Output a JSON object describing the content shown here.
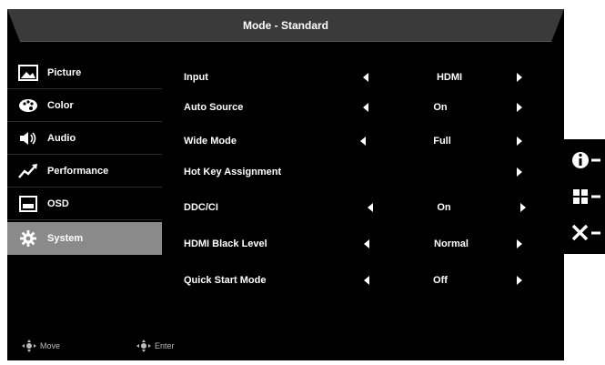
{
  "osd": {
    "title": "Mode - Standard"
  },
  "sidebar": {
    "items": [
      {
        "label": "Picture",
        "icon": "picture-icon"
      },
      {
        "label": "Color",
        "icon": "color-icon"
      },
      {
        "label": "Audio",
        "icon": "audio-icon"
      },
      {
        "label": "Performance",
        "icon": "performance-icon"
      },
      {
        "label": "OSD",
        "icon": "osd-icon"
      },
      {
        "label": "System",
        "icon": "gear-icon",
        "active": true
      }
    ]
  },
  "settings": [
    {
      "label": "Input",
      "value": "HDMI"
    },
    {
      "label": "Auto Source",
      "value": "On"
    },
    {
      "label": "Wide Mode",
      "value": "Full"
    },
    {
      "label": "Hot Key Assignment",
      "value": ""
    },
    {
      "label": "DDC/CI",
      "value": "On"
    },
    {
      "label": "HDMI Black Level",
      "value": "Normal"
    },
    {
      "label": "Quick Start Mode",
      "value": "Off"
    }
  ],
  "footer": {
    "move_label": "Move",
    "enter_label": "Enter"
  },
  "side_buttons": [
    {
      "icon": "info-icon"
    },
    {
      "icon": "menu-grid-icon"
    },
    {
      "icon": "close-icon"
    }
  ],
  "colors": {
    "background": "#000000",
    "text": "#ffffff",
    "active_item": "#8a8a8a"
  }
}
